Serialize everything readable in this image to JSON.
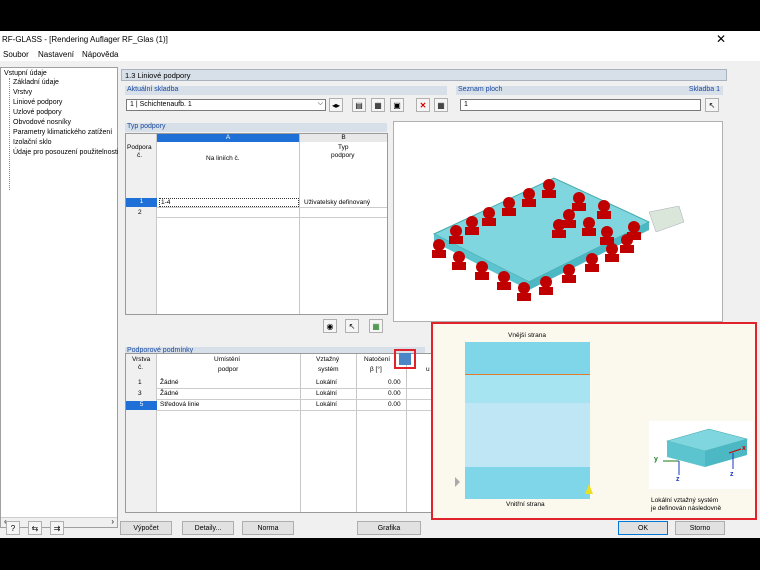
{
  "window": {
    "title": "RF-GLASS - [Rendering Auflager RF_Glas (1)]",
    "close": "✕"
  },
  "menu": [
    "Soubor",
    "Nastavení",
    "Nápověda"
  ],
  "tree": {
    "root": "Vstupní údaje",
    "items": [
      "Základní údaje",
      "Vrstvy",
      "Liniové podpory",
      "Uzlové podpory",
      "Obvodové nosníky",
      "Parametry klimatického zatížení",
      "Izolační sklo",
      "Údaje pro posouzení použitelnosti"
    ]
  },
  "panel": {
    "title": "1.3 Liniové podpory"
  },
  "current_layer": {
    "label": "Aktuální skladba",
    "value": "1 | Schichtenaufb. 1"
  },
  "surfaces": {
    "label": "Seznam ploch",
    "right_label": "Skladba 1",
    "value": "1"
  },
  "support_type": {
    "label": "Typ podpory",
    "col_a": "A",
    "col_b": "B",
    "row_hdr": [
      "Podpora",
      "č."
    ],
    "col_a_hdr": "Na liniích č.",
    "col_b_hdr": [
      "Typ",
      "podpory"
    ],
    "rows": [
      {
        "no": "1",
        "lines": "1-4",
        "type": "Uživatelsky definovaný"
      },
      {
        "no": "2",
        "lines": "",
        "type": ""
      }
    ]
  },
  "boundary": {
    "label": "Podporové podmínky",
    "headers": [
      "Vrstva",
      "č.",
      "Umístění",
      "podpor",
      "Vztažný",
      "systém",
      "Natočení",
      "β [°]"
    ],
    "extra_hdr": "u",
    "rows": [
      {
        "no": "1",
        "place": "Žádné",
        "sys": "Lokální",
        "rot": "0.00"
      },
      {
        "no": "3",
        "place": "Žádné",
        "sys": "Lokální",
        "rot": "0.00"
      },
      {
        "no": "5",
        "place": "Středová linie",
        "sys": "Lokální",
        "rot": "0.00"
      }
    ]
  },
  "callout": {
    "outer": "Vnější strana",
    "inner": "Vnitřní strana",
    "axes": {
      "y": "y",
      "z1": "z",
      "z2": "z",
      "x": "x"
    },
    "note": [
      "Lokální vztažný systém",
      "je definován následovně"
    ]
  },
  "buttons": {
    "calc": "Výpočet",
    "details": "Detaily...",
    "norm": "Norma",
    "graphics": "Grafika",
    "ok": "OK",
    "cancel": "Storno"
  },
  "colors": {
    "accent": "#0078d7",
    "highlight": "#e0222a",
    "support": "#c00000",
    "glass": "#7fd6df"
  }
}
